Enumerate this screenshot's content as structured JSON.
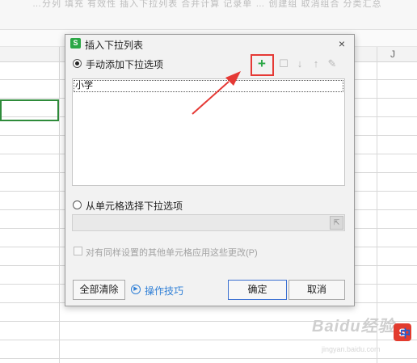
{
  "background": {
    "ribbon_text": "…分列  填充  有效性  插入下拉列表  合并计算  记录单  …  创建组  取消组合  分类汇总",
    "column_letter": "J",
    "watermark": "Baidu经验",
    "watermark_url": "jingyan.baidu.com",
    "badge_letter": "S",
    "badge_cn": "中"
  },
  "dialog": {
    "app_icon_letter": "S",
    "title": "插入下拉列表",
    "close_label": "×",
    "manual_option": {
      "label": "手动添加下拉选项",
      "selected": true
    },
    "toolbar": {
      "add_icon": "add-item-icon",
      "delete_icon": "delete-item-icon",
      "move_down_icon": "arrow-down-icon",
      "move_up_icon": "arrow-up-icon",
      "edit_icon": "pencil-icon"
    },
    "items": [
      "小学"
    ],
    "cell_option": {
      "label": "从单元格选择下拉选项",
      "selected": false
    },
    "range_value": "",
    "apply_same": {
      "label": "对有同样设置的其他单元格应用这些更改(P)",
      "checked": false,
      "enabled": false
    },
    "clear_all_label": "全部清除",
    "help_link_label": "操作技巧",
    "ok_label": "确定",
    "cancel_label": "取消"
  },
  "colors": {
    "highlight": "#e53935",
    "accent_green": "#2aa745",
    "link_blue": "#2f7fd6"
  }
}
